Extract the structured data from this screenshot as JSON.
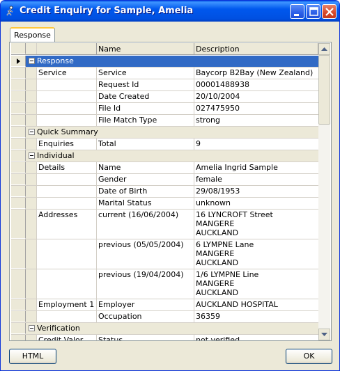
{
  "window": {
    "title": "Credit Enquiry for Sample, Amelia"
  },
  "tabs": [
    {
      "label": "Response"
    }
  ],
  "grid": {
    "columns": {
      "name": "Name",
      "description": "Description"
    },
    "rows": [
      {
        "kind": "group",
        "label": "Response",
        "selected": true
      },
      {
        "kind": "data",
        "section": "Service",
        "name": "Service",
        "desc": "Baycorp B2Bay (New Zealand)"
      },
      {
        "kind": "data",
        "section": "",
        "name": "Request Id",
        "desc": "00001488938"
      },
      {
        "kind": "data",
        "section": "",
        "name": "Date Created",
        "desc": "20/10/2004"
      },
      {
        "kind": "data",
        "section": "",
        "name": "File Id",
        "desc": "027475950"
      },
      {
        "kind": "data",
        "section": "",
        "name": "File Match Type",
        "desc": "strong"
      },
      {
        "kind": "group",
        "label": "Quick Summary"
      },
      {
        "kind": "data",
        "section": "Enquiries",
        "name": "Total",
        "desc": "9"
      },
      {
        "kind": "group",
        "label": "Individual"
      },
      {
        "kind": "data",
        "section": "Details",
        "name": "Name",
        "desc": "Amelia Ingrid Sample"
      },
      {
        "kind": "data",
        "section": "",
        "name": "Gender",
        "desc": "female"
      },
      {
        "kind": "data",
        "section": "",
        "name": "Date of Birth",
        "desc": "29/08/1953"
      },
      {
        "kind": "data",
        "section": "",
        "name": "Marital Status",
        "desc": "unknown"
      },
      {
        "kind": "data",
        "section": "Addresses",
        "name": "current (16/06/2004)",
        "desc": "16 LYNCROFT Street\nMANGERE\nAUCKLAND",
        "lines": 3
      },
      {
        "kind": "data",
        "section": "",
        "name": "previous (05/05/2004)",
        "desc": "6 LYMPNE Lane\nMANGERE\nAUCKLAND",
        "lines": 3
      },
      {
        "kind": "data",
        "section": "",
        "name": "previous (19/04/2004)",
        "desc": "1/6 LYMPNE Line\nMANGERE\nAUCKLAND",
        "lines": 3
      },
      {
        "kind": "data",
        "section": "Employment 1",
        "name": "Employer",
        "desc": "AUCKLAND HOSPITAL"
      },
      {
        "kind": "data",
        "section": "",
        "name": "Occupation",
        "desc": "36359"
      },
      {
        "kind": "group",
        "label": "Verification"
      },
      {
        "kind": "data",
        "section": "Credit Valor",
        "name": "Status",
        "desc": "not verified"
      }
    ]
  },
  "buttons": {
    "html": "HTML",
    "ok": "OK"
  },
  "colors": {
    "selection": "#316ac5",
    "titlebar": "#0058ee"
  },
  "icons": {
    "app": "running-figure-icon",
    "minimize": "minimize-icon",
    "maximize": "maximize-icon",
    "close": "close-icon"
  }
}
